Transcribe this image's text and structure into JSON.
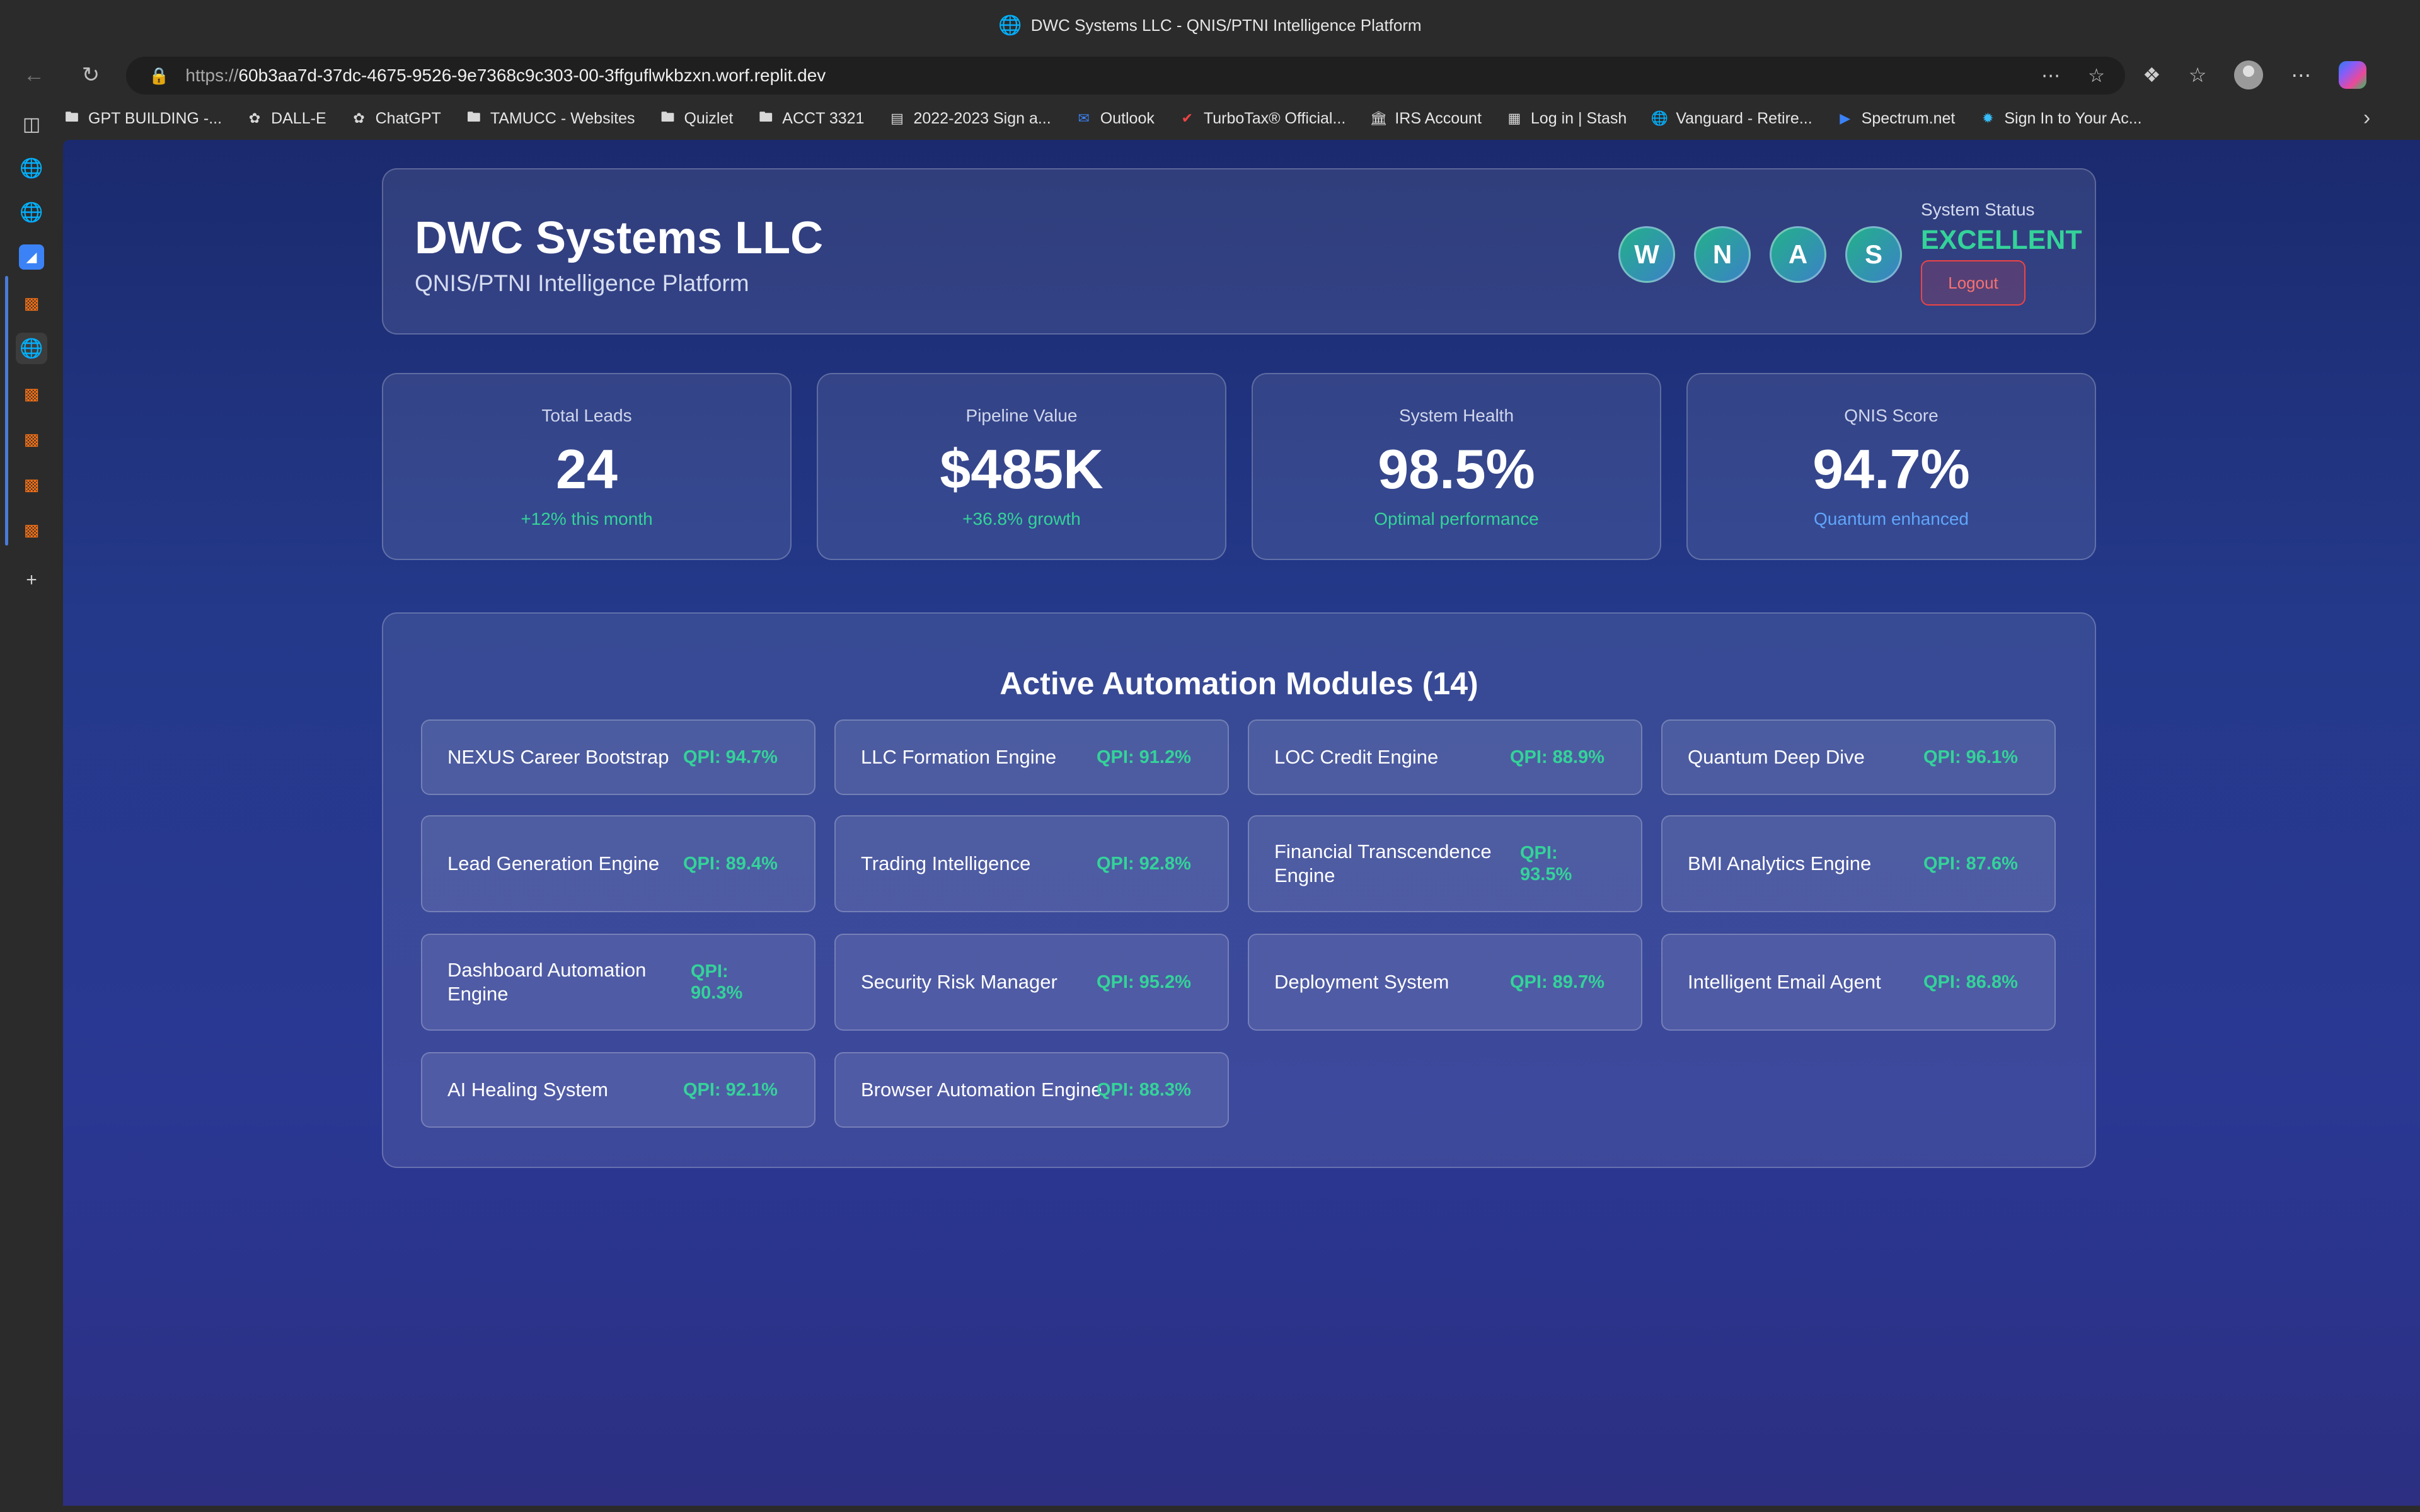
{
  "browser": {
    "window_title": "DWC Systems LLC - QNIS/PTNI Intelligence Platform",
    "url_proto": "https://",
    "url_rest": "60b3aa7d-37dc-4675-9526-9e7368c9c303-00-3ffguflwkbzxn.worf.replit.dev",
    "bookmarks": [
      {
        "label": "GPT BUILDING -...",
        "icon": "folder-icon"
      },
      {
        "label": "DALL-E",
        "icon": "openai-icon"
      },
      {
        "label": "ChatGPT",
        "icon": "openai-icon"
      },
      {
        "label": "TAMUCC - Websites",
        "icon": "folder-icon"
      },
      {
        "label": "Quizlet",
        "icon": "folder-icon"
      },
      {
        "label": "ACCT 3321",
        "icon": "folder-icon"
      },
      {
        "label": "2022-2023 Sign a...",
        "icon": "doc-icon"
      },
      {
        "label": "Outlook",
        "icon": "outlook-icon"
      },
      {
        "label": "TurboTax® Official...",
        "icon": "turbotax-icon"
      },
      {
        "label": "IRS Account",
        "icon": "irs-icon"
      },
      {
        "label": "Log in | Stash",
        "icon": "stash-icon"
      },
      {
        "label": "Vanguard - Retire...",
        "icon": "globe-icon"
      },
      {
        "label": "Spectrum.net",
        "icon": "play-icon"
      },
      {
        "label": "Sign In to Your Ac...",
        "icon": "star-icon"
      }
    ]
  },
  "header": {
    "title": "DWC Systems LLC",
    "subtitle": "QNIS/PTNI Intelligence Platform",
    "agents": [
      "W",
      "N",
      "A",
      "S"
    ],
    "status_label": "System Status",
    "status_value": "EXCELLENT",
    "logout_label": "Logout"
  },
  "metrics": [
    {
      "label": "Total Leads",
      "value": "24",
      "sub": "+12% this month"
    },
    {
      "label": "Pipeline Value",
      "value": "$485K",
      "sub": "+36.8% growth"
    },
    {
      "label": "System Health",
      "value": "98.5%",
      "sub": "Optimal performance"
    },
    {
      "label": "QNIS Score",
      "value": "94.7%",
      "sub": "Quantum enhanced"
    }
  ],
  "modules": {
    "title": "Active Automation Modules (14)",
    "items": [
      {
        "name": "NEXUS Career Bootstrap",
        "qpi": "QPI: 94.7%"
      },
      {
        "name": "LLC Formation Engine",
        "qpi": "QPI: 91.2%"
      },
      {
        "name": "LOC Credit Engine",
        "qpi": "QPI: 88.9%"
      },
      {
        "name": "Quantum Deep Dive",
        "qpi": "QPI: 96.1%"
      },
      {
        "name": "Lead Generation Engine",
        "qpi": "QPI: 89.4%"
      },
      {
        "name": "Trading Intelligence",
        "qpi": "QPI: 92.8%"
      },
      {
        "name": "Financial Transcendence Engine",
        "qpi": "QPI: 93.5%"
      },
      {
        "name": "BMI Analytics Engine",
        "qpi": "QPI: 87.6%"
      },
      {
        "name": "Dashboard Automation Engine",
        "qpi": "QPI: 90.3%"
      },
      {
        "name": "Security Risk Manager",
        "qpi": "QPI: 95.2%"
      },
      {
        "name": "Deployment System",
        "qpi": "QPI: 89.7%"
      },
      {
        "name": "Intelligent Email Agent",
        "qpi": "QPI: 86.8%"
      },
      {
        "name": "AI Healing System",
        "qpi": "QPI: 92.1%"
      },
      {
        "name": "Browser Automation Engine",
        "qpi": "QPI: 88.3%"
      }
    ]
  },
  "colors": {
    "accent_green": "#34d399",
    "accent_blue": "#60a5fa",
    "logout_red": "#ef4444"
  }
}
